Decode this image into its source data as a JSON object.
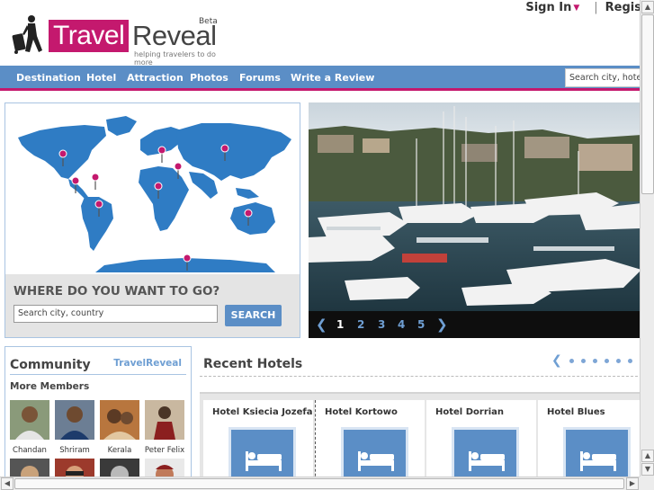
{
  "header": {
    "sign_in": "Sign In",
    "register": "Regis",
    "logo_travel": "Travel",
    "logo_reveal": "Reveal",
    "logo_beta": "Beta",
    "tagline": "helping travelers to do more"
  },
  "nav": {
    "items": [
      "Destination",
      "Hotel",
      "Attraction",
      "Photos",
      "Forums",
      "Write a Review"
    ],
    "search_placeholder": "Search city, hotel, attr"
  },
  "map": {
    "heading": "WHERE DO YOU WANT TO GO?",
    "input_placeholder": "Search city, country",
    "search_button": "SEARCH"
  },
  "slideshow": {
    "pages": [
      "1",
      "2",
      "3",
      "4",
      "5"
    ],
    "active_page": "1",
    "prev_icon": "chevron-left-icon",
    "next_icon": "chevron-right-icon"
  },
  "community": {
    "title": "Community",
    "brand": "TravelReveal",
    "more_members": "More Members",
    "members": [
      "Chandan",
      "Shriram",
      "Kerala",
      "Peter Felix"
    ]
  },
  "recent_hotels": {
    "title": "Recent Hotels",
    "hotels": [
      "Hotel Ksiecia Jozefa",
      "Hotel Kortowo",
      "Hotel Dorrian",
      "Hotel Blues"
    ],
    "pager_dots": 6
  },
  "colors": {
    "brand_pink": "#c4196e",
    "nav_blue": "#5b8ec6",
    "link_blue": "#6f9fd3"
  }
}
